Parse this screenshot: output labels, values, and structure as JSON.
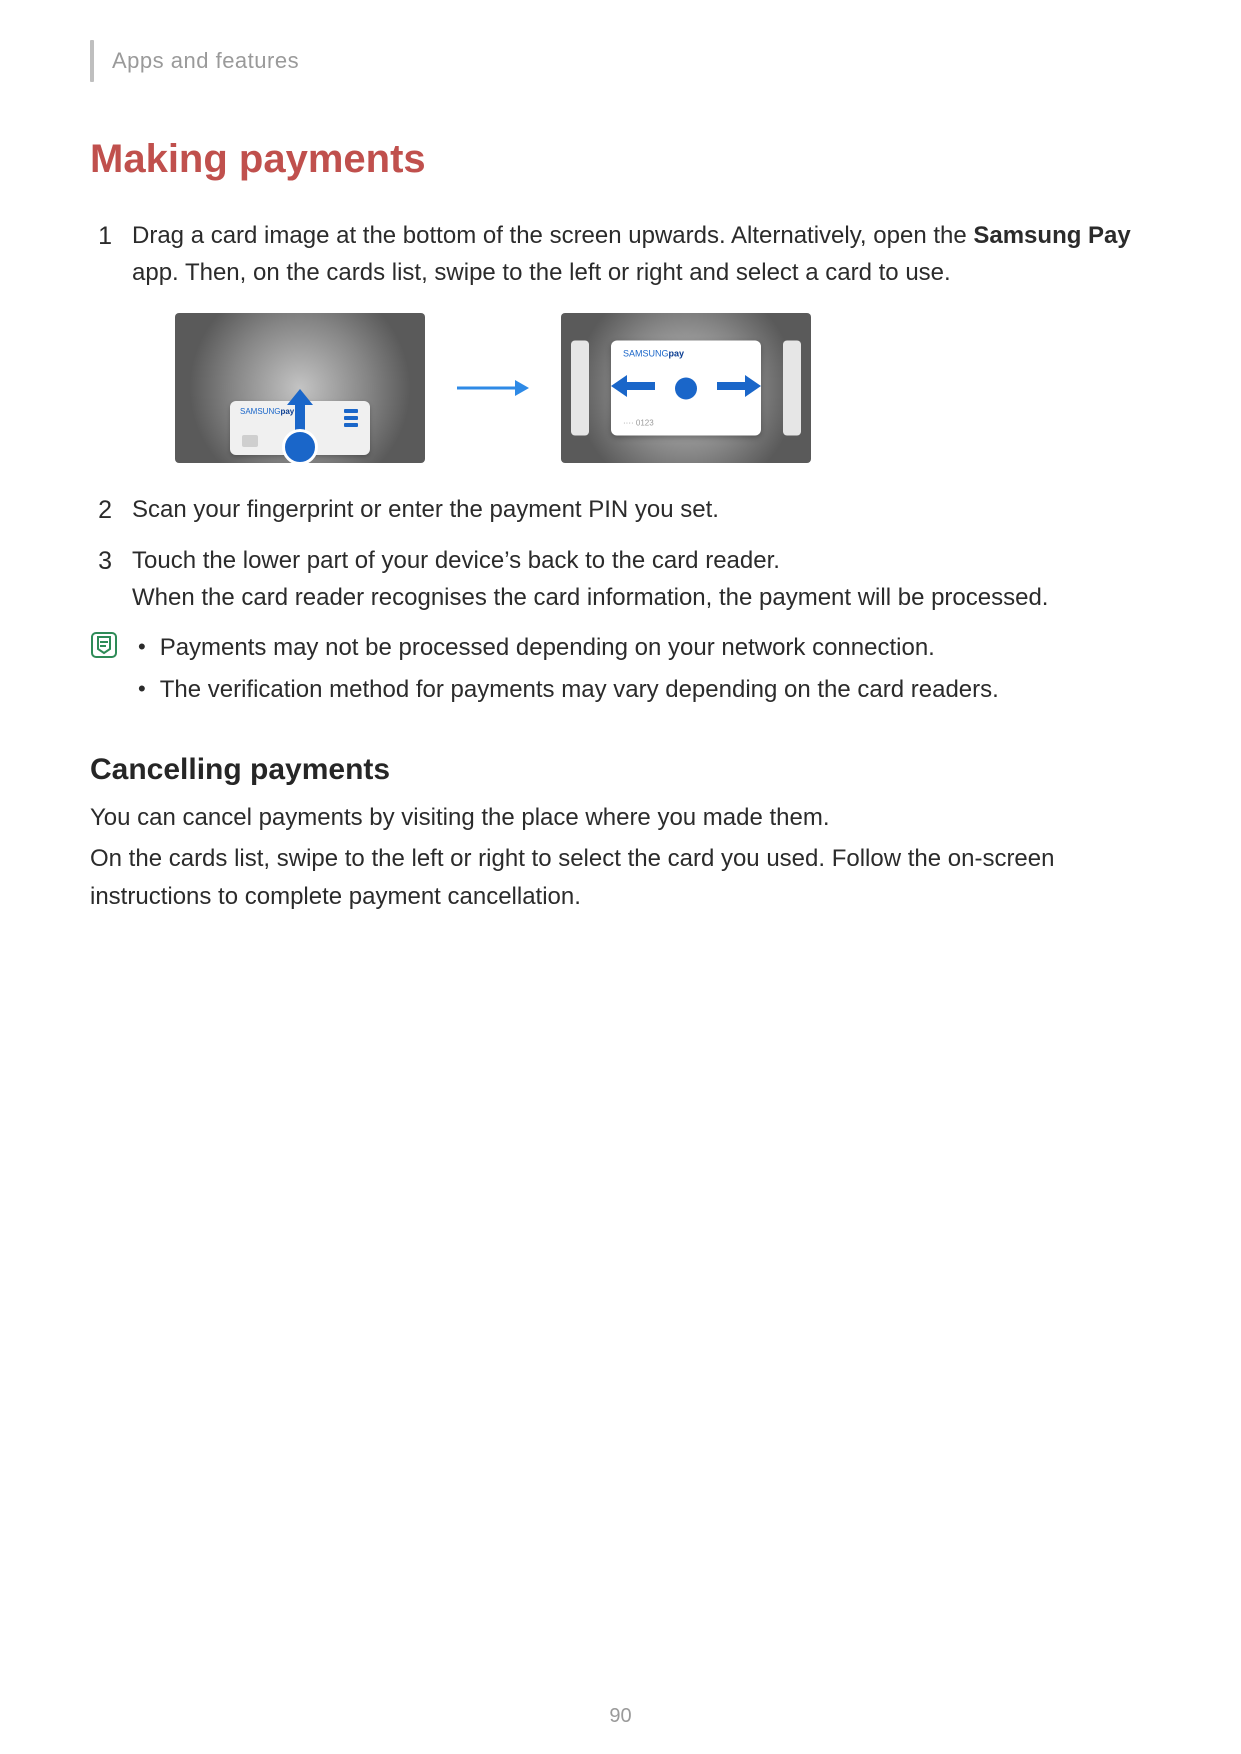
{
  "header": {
    "breadcrumb": "Apps and features"
  },
  "heading": "Making payments",
  "steps": [
    {
      "num": "1",
      "text_before": "Drag a card image at the bottom of the screen upwards. Alternatively, open the ",
      "bold": "Samsung Pay",
      "text_after": " app. Then, on the cards list, swipe to the left or right and select a card to use."
    },
    {
      "num": "2",
      "text": "Scan your fingerprint or enter the payment PIN you set."
    },
    {
      "num": "3",
      "line1": "Touch the lower part of your device’s back to the card reader.",
      "line2": "When the card reader recognises the card information, the payment will be processed."
    }
  ],
  "illustration": {
    "card_brand_prefix": "SAMSUNG",
    "card_brand_suffix": "pay",
    "card_masked_number": "···· 0123"
  },
  "note": {
    "items": [
      "Payments may not be processed depending on your network connection.",
      "The verification method for payments may vary depending on the card readers."
    ]
  },
  "cancelling": {
    "heading": "Cancelling payments",
    "p1": "You can cancel payments by visiting the place where you made them.",
    "p2": "On the cards list, swipe to the left or right to select the card you used. Follow the on-screen instructions to complete payment cancellation."
  },
  "page_number": "90"
}
